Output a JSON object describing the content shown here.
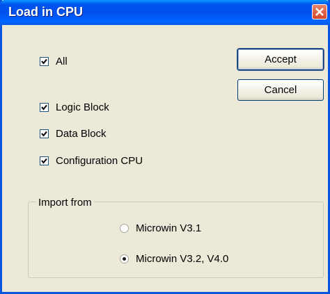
{
  "window": {
    "title": "Load in CPU"
  },
  "checkboxes": {
    "all": {
      "label": "All",
      "checked": true
    },
    "logic_block": {
      "label": "Logic Block",
      "checked": true
    },
    "data_block": {
      "label": "Data Block",
      "checked": true
    },
    "configuration_cpu": {
      "label": "Configuration CPU",
      "checked": true
    }
  },
  "buttons": {
    "accept": "Accept",
    "cancel": "Cancel"
  },
  "import_from": {
    "title": "Import from",
    "options": [
      {
        "label": "Microwin V3.1",
        "selected": false
      },
      {
        "label": "Microwin V3.2, V4.0",
        "selected": true
      }
    ]
  }
}
